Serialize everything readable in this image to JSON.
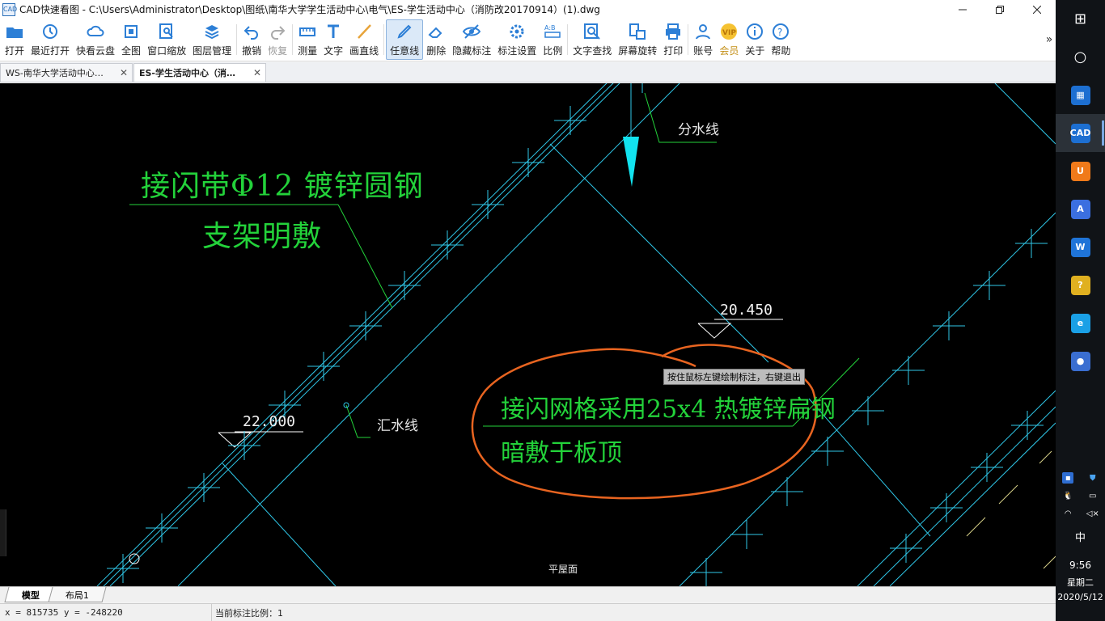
{
  "window": {
    "title": "CAD快速看图 - C:\\Users\\Administrator\\Desktop\\图纸\\南华大学学生活动中心\\电气\\ES-学生活动中心（消防改20170914）(1).dwg",
    "app_icon_text": "CAD"
  },
  "toolbar": [
    {
      "label": "打开",
      "icon": "open-folder-icon"
    },
    {
      "label": "最近打开",
      "icon": "recent-clock-icon"
    },
    {
      "label": "快看云盘",
      "icon": "cloud-icon"
    },
    {
      "label": "全图",
      "icon": "fit-all-icon"
    },
    {
      "label": "窗口缩放",
      "icon": "window-zoom-icon"
    },
    {
      "label": "图层管理",
      "icon": "layers-icon"
    },
    {
      "label": "撤销",
      "icon": "undo-icon"
    },
    {
      "label": "恢复",
      "icon": "redo-icon",
      "disabled": true
    },
    {
      "label": "测量",
      "icon": "ruler-icon"
    },
    {
      "label": "文字",
      "icon": "text-icon"
    },
    {
      "label": "画直线",
      "icon": "line-icon"
    },
    {
      "label": "任意线",
      "icon": "freehand-pen-icon",
      "active": true
    },
    {
      "label": "删除",
      "icon": "eraser-icon"
    },
    {
      "label": "隐藏标注",
      "icon": "eye-hide-icon"
    },
    {
      "label": "标注设置",
      "icon": "annotation-settings-icon"
    },
    {
      "label": "比例",
      "icon": "scale-icon"
    },
    {
      "label": "文字查找",
      "icon": "text-search-icon"
    },
    {
      "label": "屏幕旋转",
      "icon": "rotate-screen-icon"
    },
    {
      "label": "打印",
      "icon": "printer-icon"
    },
    {
      "label": "账号",
      "icon": "user-icon"
    },
    {
      "label": "会员",
      "icon": "vip-icon",
      "vip": true
    },
    {
      "label": "关于",
      "icon": "info-icon"
    },
    {
      "label": "帮助",
      "icon": "help-icon"
    }
  ],
  "toolbar_more": "»",
  "tabs": [
    {
      "label": "WS-南华大学活动中心…",
      "close": "✕"
    },
    {
      "label": "ES-学生活动中心（消…",
      "close": "✕",
      "active": true
    }
  ],
  "drawing": {
    "note1_line1": "接闪带Φ12 镀锌圆钢",
    "note1_line2": "支架明敷",
    "note2_line1": "接闪网格采用25x4 热镀锌扁钢",
    "note2_line2": "暗敷于板顶",
    "label_fenshui": "分水线",
    "label_huishui": "汇水线",
    "elev1": "20.450",
    "elev2": "22.000",
    "roof_label": "平屋面",
    "hint": "按住鼠标左键绘制标注，右键退出"
  },
  "layouts": [
    "模型",
    "布局1"
  ],
  "status": {
    "coords": "x = 815735   y = -248220",
    "scale": "当前标注比例：1"
  },
  "taskbar": {
    "apps": [
      {
        "name": "start-icon",
        "glyph": "⊞"
      },
      {
        "name": "cortana-icon",
        "glyph": "○"
      },
      {
        "name": "app-store-icon",
        "glyph": "▦",
        "color": "#1d6fd1"
      },
      {
        "name": "cad-viewer-icon",
        "glyph": "CAD",
        "color": "#1d6fd1",
        "active": true
      },
      {
        "name": "uc-browser-icon",
        "glyph": "U",
        "color": "#f07a1a"
      },
      {
        "name": "a-app-icon",
        "glyph": "A",
        "color": "#3b6fe0"
      },
      {
        "name": "wps-icon",
        "glyph": "W",
        "color": "#1f74d8"
      },
      {
        "name": "help-app-icon",
        "glyph": "?",
        "color": "#e0b020"
      },
      {
        "name": "ie-icon",
        "glyph": "e",
        "color": "#1aa0e6"
      },
      {
        "name": "lenovo-icon",
        "glyph": "●",
        "color": "#3a6ed1"
      }
    ],
    "ime": "中",
    "time": "9:56",
    "weekday": "星期二",
    "date": "2020/5/12"
  }
}
